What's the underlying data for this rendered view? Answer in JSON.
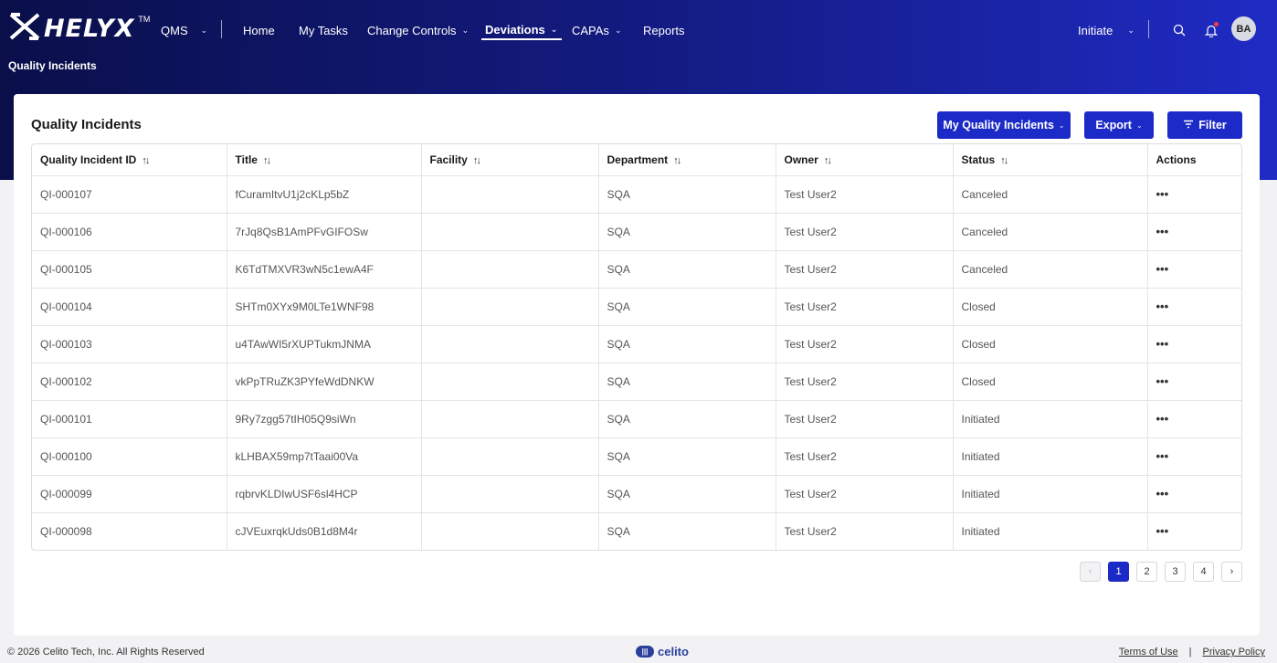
{
  "app": {
    "logo_text": "HELYX",
    "logo_tm": "TM"
  },
  "nav": {
    "module": "QMS",
    "items": [
      {
        "label": "Home"
      },
      {
        "label": "My Tasks"
      },
      {
        "label": "Change Controls"
      },
      {
        "label": "Deviations"
      },
      {
        "label": "CAPAs"
      },
      {
        "label": "Reports"
      }
    ],
    "initiate_label": "Initiate",
    "avatar_initials": "BA"
  },
  "breadcrumb": "Quality Incidents",
  "card": {
    "title": "Quality Incidents",
    "my_incidents_label": "My Quality Incidents",
    "export_label": "Export",
    "filter_label": "Filter"
  },
  "table": {
    "columns": [
      "Quality Incident ID",
      "Title",
      "Facility",
      "Department",
      "Owner",
      "Status",
      "Actions"
    ],
    "rows": [
      {
        "id": "QI-000107",
        "title": "fCuramItvU1j2cKLp5bZ",
        "facility": "",
        "department": "SQA",
        "owner": "Test User2",
        "status": "Canceled"
      },
      {
        "id": "QI-000106",
        "title": "7rJq8QsB1AmPFvGIFOSw",
        "facility": "",
        "department": "SQA",
        "owner": "Test User2",
        "status": "Canceled"
      },
      {
        "id": "QI-000105",
        "title": "K6TdTMXVR3wN5c1ewA4F",
        "facility": "",
        "department": "SQA",
        "owner": "Test User2",
        "status": "Canceled"
      },
      {
        "id": "QI-000104",
        "title": "SHTm0XYx9M0LTe1WNF98",
        "facility": "",
        "department": "SQA",
        "owner": "Test User2",
        "status": "Closed"
      },
      {
        "id": "QI-000103",
        "title": "u4TAwWI5rXUPTukmJNMA",
        "facility": "",
        "department": "SQA",
        "owner": "Test User2",
        "status": "Closed"
      },
      {
        "id": "QI-000102",
        "title": "vkPpTRuZK3PYfeWdDNKW",
        "facility": "",
        "department": "SQA",
        "owner": "Test User2",
        "status": "Closed"
      },
      {
        "id": "QI-000101",
        "title": "9Ry7zgg57tIH05Q9siWn",
        "facility": "",
        "department": "SQA",
        "owner": "Test User2",
        "status": "Initiated"
      },
      {
        "id": "QI-000100",
        "title": "kLHBAX59mp7tTaai00Va",
        "facility": "",
        "department": "SQA",
        "owner": "Test User2",
        "status": "Initiated"
      },
      {
        "id": "QI-000099",
        "title": "rqbrvKLDIwUSF6sl4HCP",
        "facility": "",
        "department": "SQA",
        "owner": "Test User2",
        "status": "Initiated"
      },
      {
        "id": "QI-000098",
        "title": "cJVEuxrqkUds0B1d8M4r",
        "facility": "",
        "department": "SQA",
        "owner": "Test User2",
        "status": "Initiated"
      }
    ],
    "actions_glyph": "•••"
  },
  "pagination": {
    "prev": "‹",
    "pages": [
      "1",
      "2",
      "3",
      "4"
    ],
    "current": "1",
    "next": "›"
  },
  "footer": {
    "copyright": "© 2026 Celito Tech, Inc. All Rights Reserved",
    "brand": "celito",
    "terms": "Terms of Use",
    "separator": "|",
    "privacy": "Privacy Policy"
  },
  "colors": {
    "primary": "#1c2ac7",
    "header_dark": "#0a0f4a",
    "header_light": "#1f2bc4"
  },
  "icons": [
    "helyx-logo-icon",
    "search-icon",
    "bell-icon",
    "filter-icon",
    "sort-icon",
    "chevron-down-icon",
    "more-icon"
  ]
}
